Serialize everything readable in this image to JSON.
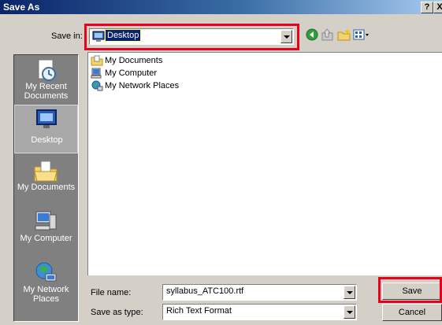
{
  "window": {
    "title": "Save As",
    "help_label": "?",
    "close_label": "X"
  },
  "save_in": {
    "label": "Save in:",
    "value": "Desktop"
  },
  "toolbar": {
    "icons": [
      "back-icon",
      "up-folder-icon",
      "new-folder-icon",
      "views-menu-icon"
    ]
  },
  "places": [
    {
      "label": "My Recent Documents",
      "icon": "recent-documents-icon"
    },
    {
      "label": "Desktop",
      "icon": "desktop-icon",
      "selected": true
    },
    {
      "label": "My Documents",
      "icon": "my-documents-icon"
    },
    {
      "label": "My Computer",
      "icon": "my-computer-icon"
    },
    {
      "label": "My Network Places",
      "icon": "network-places-icon"
    }
  ],
  "files": [
    {
      "name": "My Documents",
      "icon": "folder-documents-icon"
    },
    {
      "name": "My Computer",
      "icon": "computer-icon"
    },
    {
      "name": "My Network Places",
      "icon": "network-icon"
    }
  ],
  "file_name": {
    "label": "File name:",
    "value": "syllabus_ATC100.rtf"
  },
  "save_as_type": {
    "label": "Save as type:",
    "value": "Rich Text Format"
  },
  "buttons": {
    "save": "Save",
    "cancel": "Cancel"
  },
  "colors": {
    "highlight": "#e8001c",
    "title_bar": "#0a246a",
    "selection": "#0a246a"
  }
}
